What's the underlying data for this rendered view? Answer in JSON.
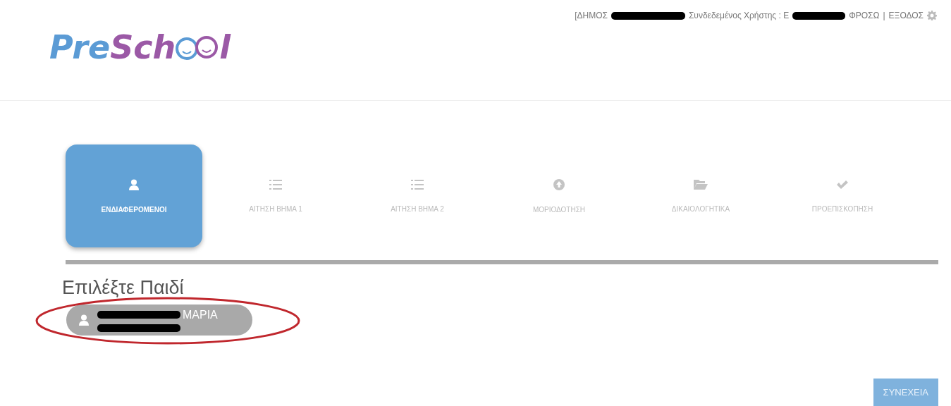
{
  "logo": {
    "first": "PreSch",
    "last": "l"
  },
  "user_bar": {
    "segments": [
      {
        "kind": "text",
        "text": "[ΔΗΜΟΣ"
      },
      {
        "kind": "redacted"
      },
      {
        "kind": "text",
        "text": "Συνδεδεμένος Χρήστης : Ε"
      },
      {
        "kind": "redacted"
      },
      {
        "kind": "text",
        "text": "ΦΡΟΣΩ"
      }
    ],
    "separator": "|",
    "logout": "ΕΞΟΔΟΣ"
  },
  "steps": [
    {
      "kind": "user",
      "label": "ΕΝΔΙΑΦΕΡΟΜΕΝΟΙ",
      "selected": true
    },
    {
      "kind": "list",
      "label": "ΑΙΤΗΣΗ ΒΗΜΑ 1",
      "selected": false
    },
    {
      "kind": "list",
      "label": "ΑΙΤΗΣΗ ΒΗΜΑ 2",
      "selected": false
    },
    {
      "kind": "upload",
      "label": "ΜΟΡΙΟΔΟΤΗΣΗ",
      "selected": false
    },
    {
      "kind": "folder",
      "label": "ΔΙΚΑΙΟΛΟΓΗΤΙΚΑ",
      "selected": false
    },
    {
      "kind": "check",
      "label": "ΠΡΟΕΠΙΣΚΟΠΗΣΗ",
      "selected": false
    }
  ],
  "heading": "Επιλέξτε Παιδί",
  "children": [
    {
      "name": "ΜΑΡΙΑ",
      "circled": true
    }
  ],
  "continue_button": "ΣΥΝΕΧΕΙΑ"
}
